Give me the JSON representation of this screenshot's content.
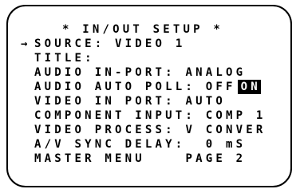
{
  "menu": {
    "title": "* IN/OUT SETUP *",
    "cursor_symbol": "→",
    "lines": [
      {
        "label": "SOURCE:",
        "value": "VIDEO 1"
      },
      {
        "label": "TITLE:",
        "value": ""
      },
      {
        "label": "AUDIO IN-PORT:",
        "value": "ANALOG"
      },
      {
        "label": "AUDIO AUTO POLL:",
        "option_off": "OFF",
        "option_on": "ON",
        "selected": "ON"
      },
      {
        "label": "VIDEO IN PORT:",
        "value": "AUTO"
      },
      {
        "label": "COMPONENT INPUT:",
        "value": "COMP 1"
      },
      {
        "label": "VIDEO PROCESS:",
        "value": "V CONVER"
      },
      {
        "label": "A/V SYNC DELAY:",
        "value": "0 mS"
      },
      {
        "label": "MASTER MENU",
        "value": "PAGE 2"
      }
    ]
  }
}
